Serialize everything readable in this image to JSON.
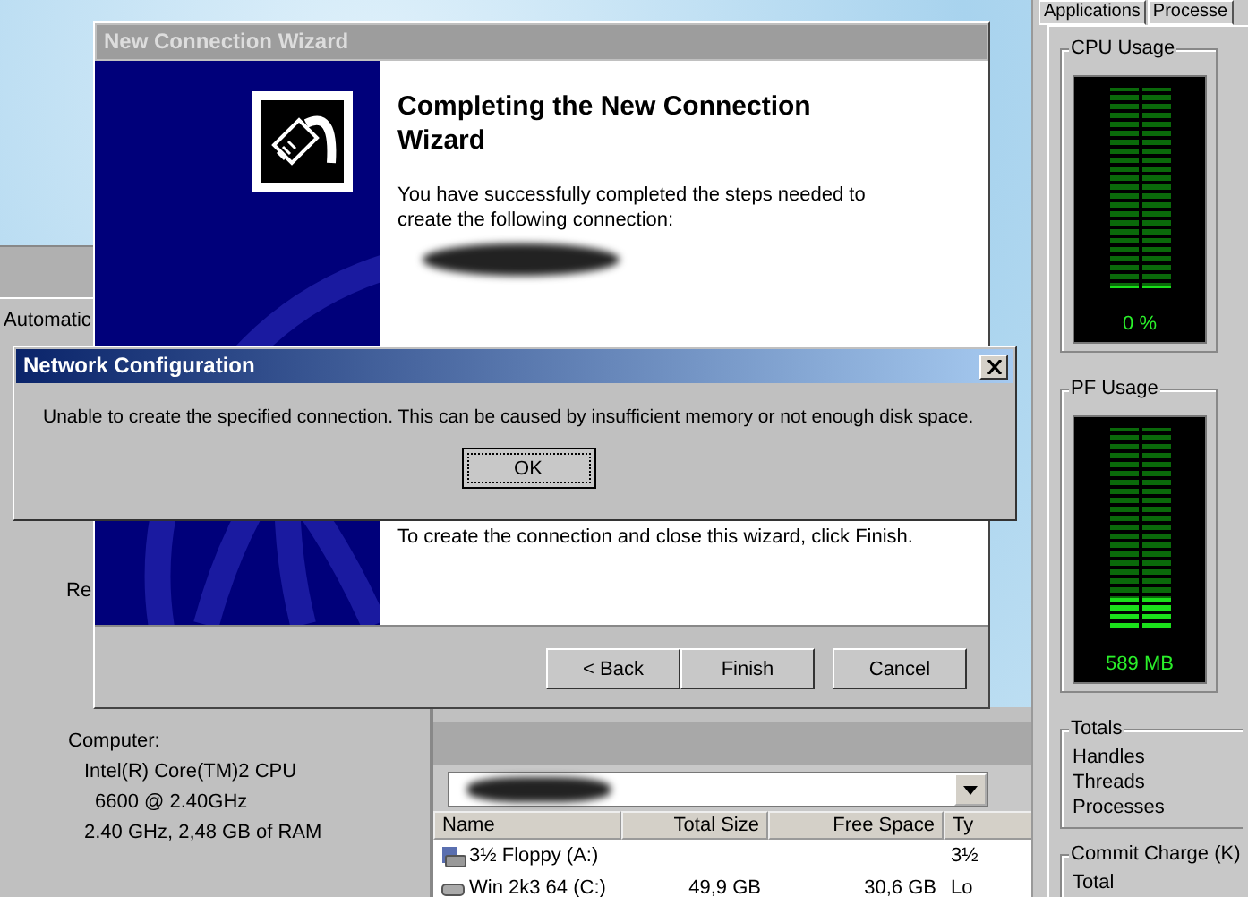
{
  "background_window": {
    "labels": [
      "Automatic",
      "Re"
    ],
    "computer_label": "Computer:",
    "computer_lines": [
      "Intel(R) Core(TM)2 CPU",
      "6600  @ 2.40GHz",
      "2.40 GHz, 2,48 GB of RAM"
    ]
  },
  "explorer": {
    "columns": [
      "Name",
      "Total Size",
      "Free Space",
      "Ty"
    ],
    "rows": [
      {
        "kind": "floppy",
        "name": "3½ Floppy (A:)",
        "type": "3½"
      },
      {
        "kind": "disk",
        "name": "Win 2k3 64 (C:)",
        "total_size": "49,9 GB",
        "free_space": "30,6 GB",
        "type": "Lo"
      }
    ]
  },
  "task_manager": {
    "tabs": [
      {
        "label": "Applications",
        "selected": false
      },
      {
        "label": "Processe",
        "selected": false
      }
    ],
    "meters": [
      {
        "title": "CPU Usage",
        "level": 0,
        "reading": "0 %"
      },
      {
        "title": "PF Usage",
        "level": 0.15,
        "reading": "589 MB"
      }
    ],
    "totals": {
      "title": "Totals",
      "rows": [
        "Handles",
        "Threads",
        "Processes"
      ]
    },
    "commit_charge": {
      "title": "Commit Charge (K)",
      "rows": [
        "Total"
      ]
    }
  },
  "wizard": {
    "title": "New Connection Wizard",
    "active": false,
    "heading": "Completing the New Connection Wizard",
    "intro": "You have successfully completed the steps needed to create the following connection:",
    "finish_note": "To create the connection and close this wizard, click Finish.",
    "buttons": [
      "< Back",
      "Finish",
      "Cancel"
    ]
  },
  "dialog": {
    "title": "Network Configuration",
    "active": true,
    "message": "Unable to create the specified connection.  This can be caused by insufficient memory or not enough disk space.",
    "button": "OK"
  }
}
